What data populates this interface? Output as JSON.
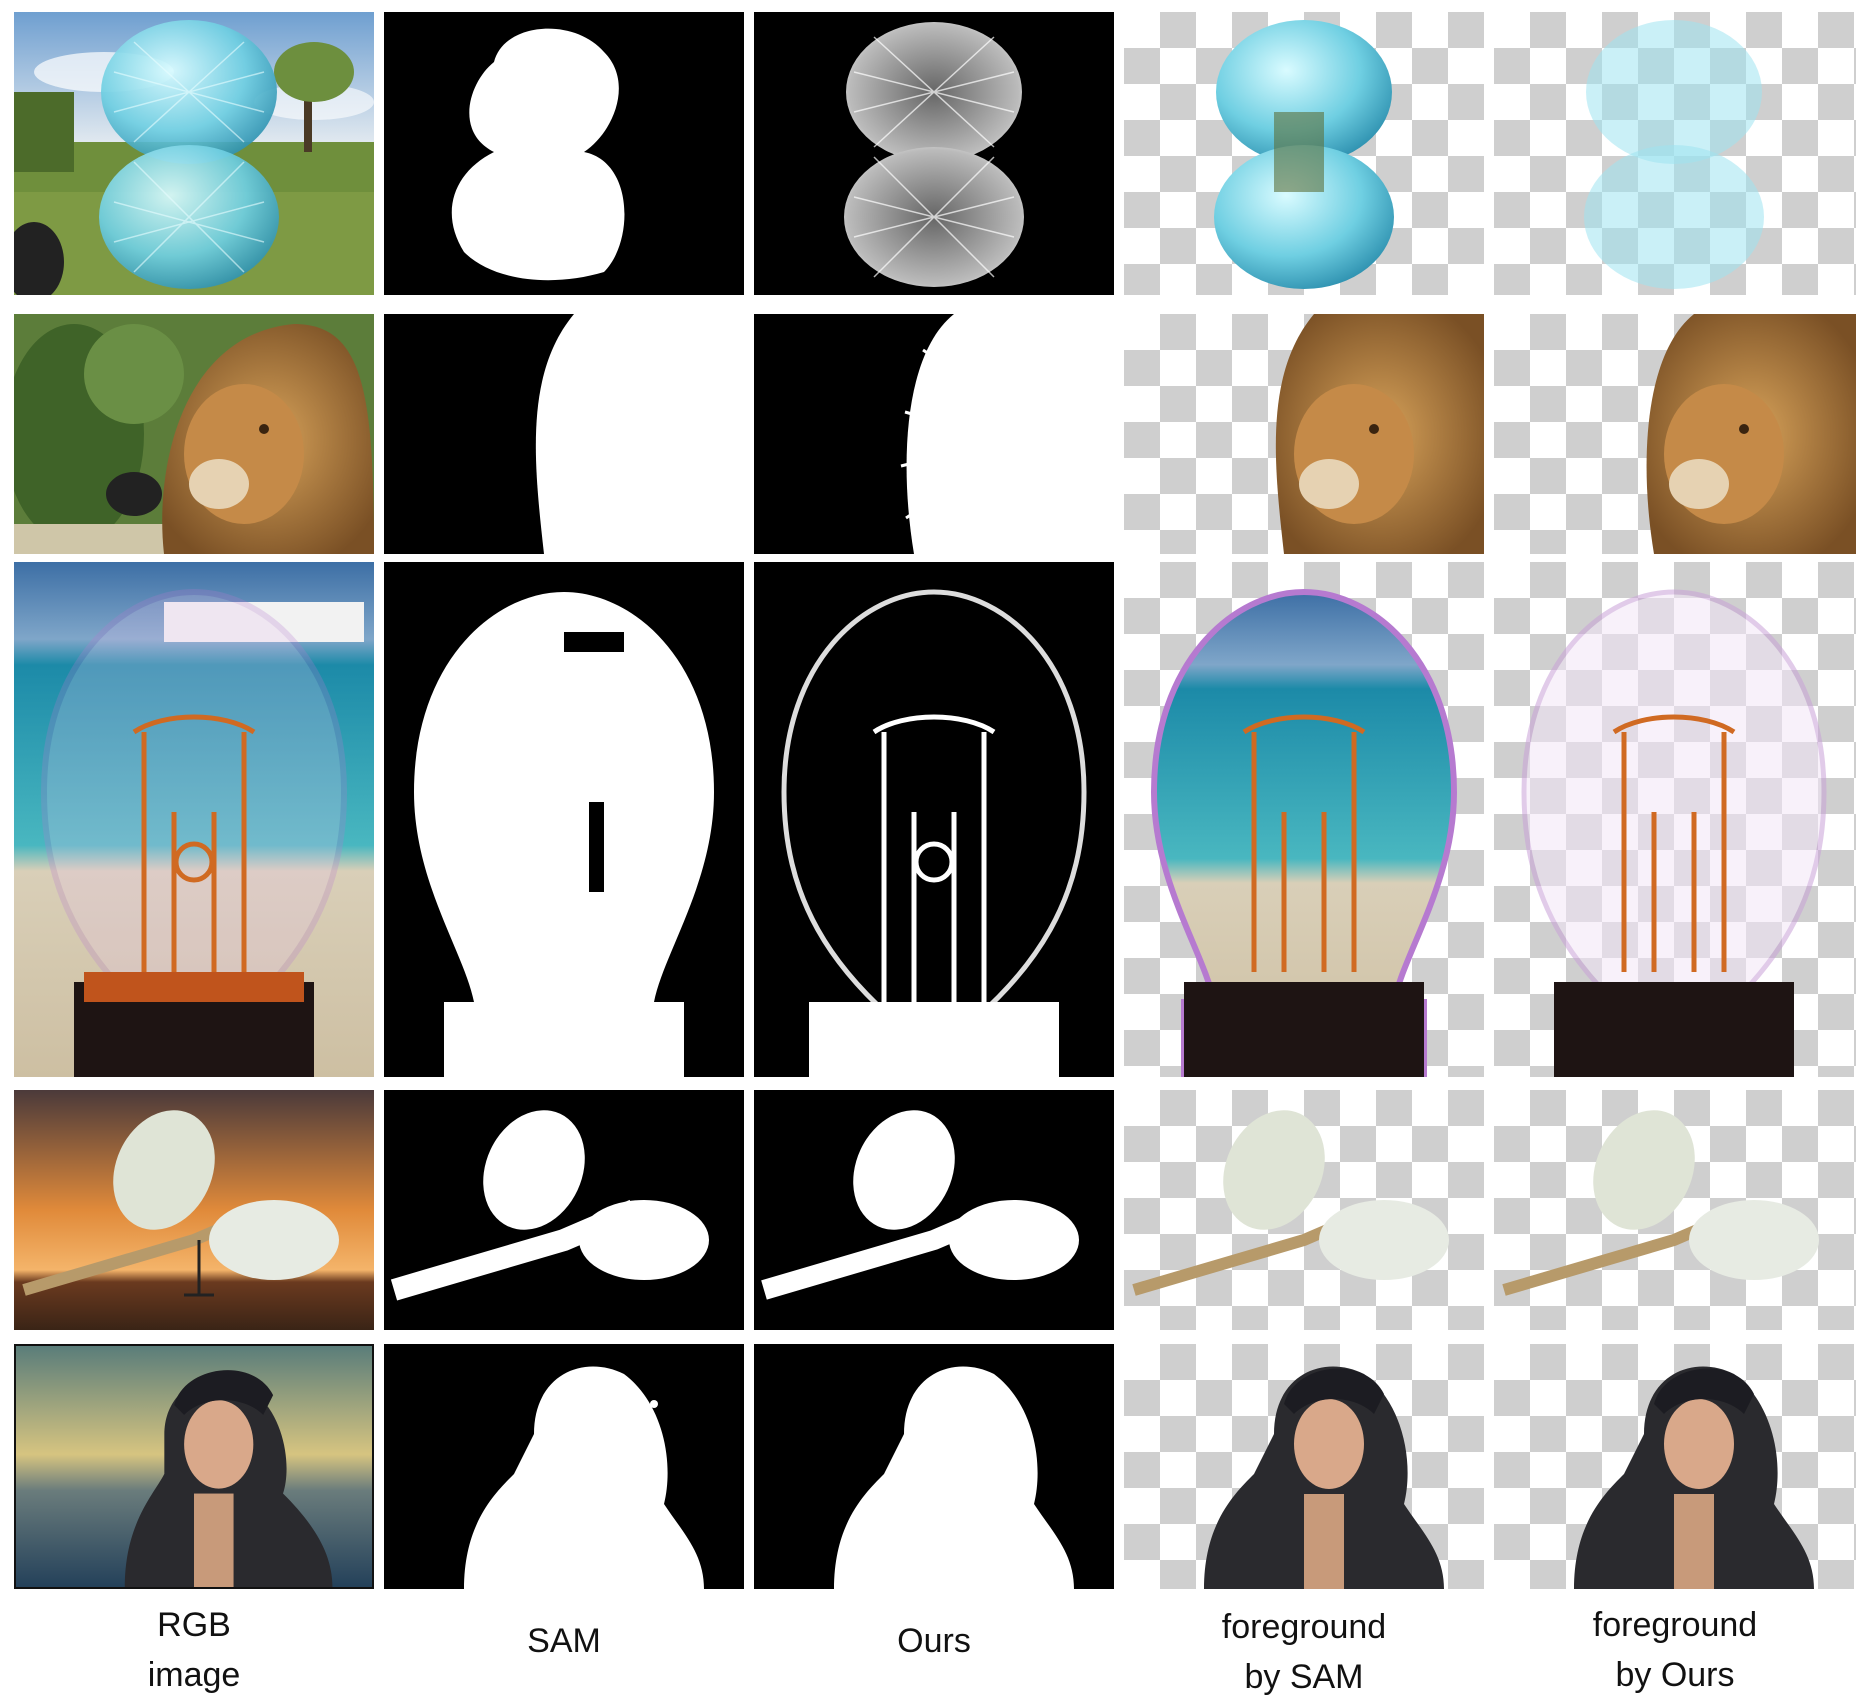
{
  "figure": {
    "columns": [
      {
        "lines": [
          "RGB",
          "image"
        ]
      },
      {
        "lines": [
          "SAM"
        ]
      },
      {
        "lines": [
          "Ours"
        ]
      },
      {
        "lines": [
          "foreground",
          "by SAM"
        ]
      },
      {
        "lines": [
          "foreground",
          "by Ours"
        ]
      }
    ],
    "rows": [
      {
        "subject": "crystal eggs over grassland"
      },
      {
        "subject": "lion head"
      },
      {
        "subject": "light bulb on beach"
      },
      {
        "subject": "pussy willow branch at sunset"
      },
      {
        "subject": "woman in fur hat by the sea"
      }
    ]
  }
}
